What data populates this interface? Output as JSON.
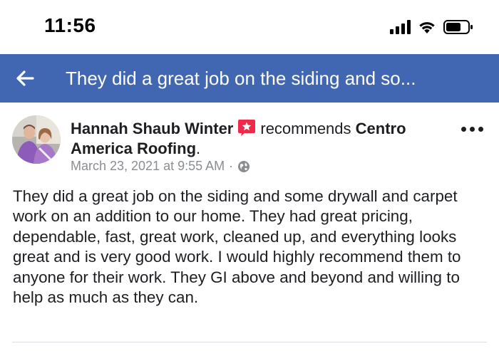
{
  "status_bar": {
    "time": "11:56"
  },
  "nav": {
    "title": "They did a great job on the siding and so..."
  },
  "post": {
    "author": "Hannah Shaub Winter",
    "recommends_text": "recommends",
    "page_name": "Centro America Roofing",
    "period": ".",
    "timestamp": "March 23, 2021 at 9:55 AM",
    "separator": "·",
    "body": "They did a great job on the siding and some drywall and carpet work on an addition to our home. They had great pricing, dependable, fast, great work, cleaned up, and everything looks great and is very good work. I would highly recommend them to anyone for their work. They GI above and beyond and willing to help as much as they can."
  },
  "colors": {
    "nav_background": "#4267b2",
    "recommend_badge": "#f02849",
    "meta_text": "#8a8d91"
  },
  "icons": {
    "back": "back-arrow-icon",
    "recommend": "recommend-star-icon",
    "privacy": "globe-icon",
    "more": "more-options-icon",
    "signal": "cellular-signal-icon",
    "wifi": "wifi-icon",
    "battery": "battery-icon"
  }
}
